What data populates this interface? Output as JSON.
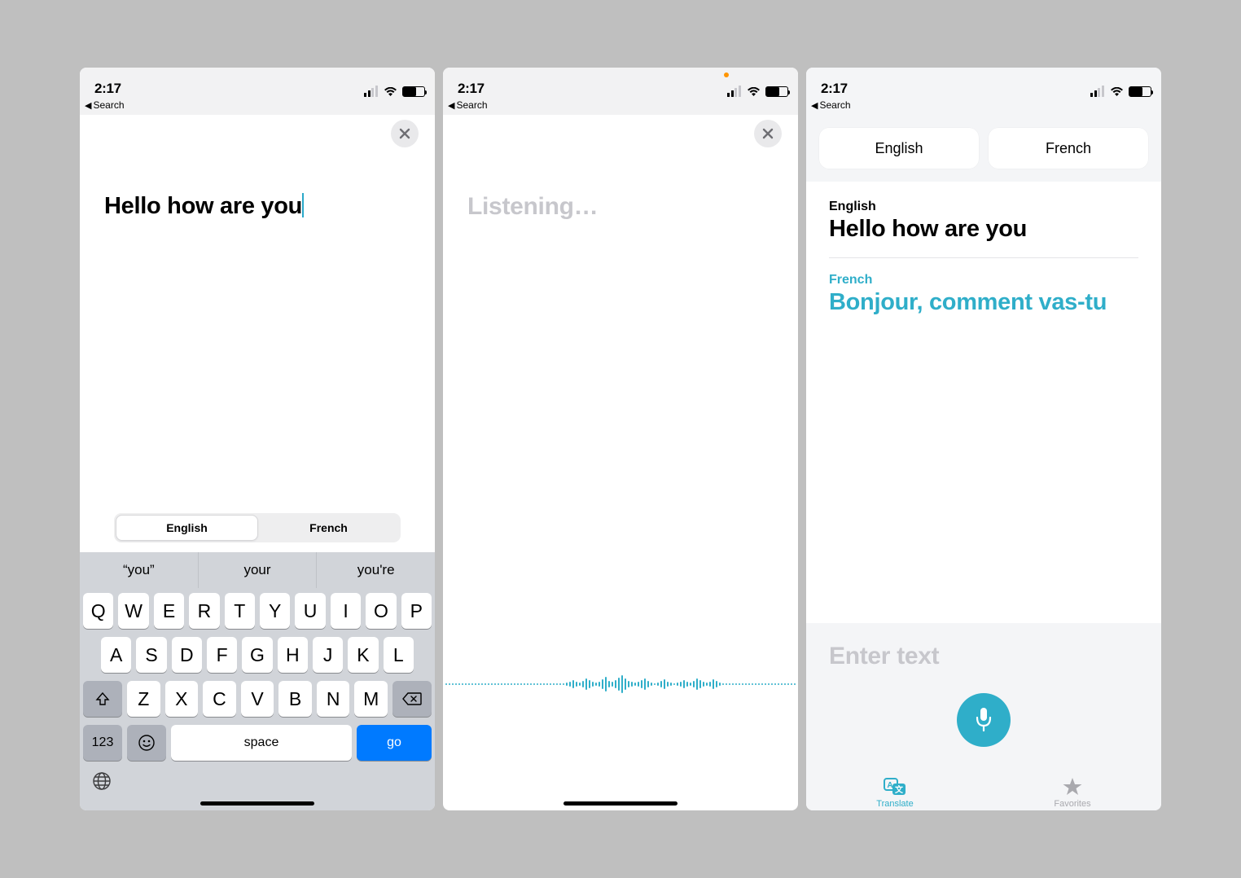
{
  "status": {
    "time": "2:17",
    "back_label": "Search"
  },
  "screen1": {
    "typed_text": "Hello how are you",
    "seg": {
      "source": "English",
      "target": "French"
    },
    "keyboard": {
      "suggestions": [
        "“you”",
        "your",
        "you're"
      ],
      "row1": [
        "Q",
        "W",
        "E",
        "R",
        "T",
        "Y",
        "U",
        "I",
        "O",
        "P"
      ],
      "row2": [
        "A",
        "S",
        "D",
        "F",
        "G",
        "H",
        "J",
        "K",
        "L"
      ],
      "row3": [
        "Z",
        "X",
        "C",
        "V",
        "B",
        "N",
        "M"
      ],
      "num_key": "123",
      "space_key": "space",
      "go_key": "go"
    }
  },
  "screen2": {
    "listening_label": "Listening…"
  },
  "screen3": {
    "pills": {
      "source": "English",
      "target": "French"
    },
    "result": {
      "source_label": "English",
      "source_text": "Hello how are you",
      "target_label": "French",
      "target_text": "Bonjour, comment vas-tu"
    },
    "enter_placeholder": "Enter text",
    "tabs": {
      "translate": "Translate",
      "favorites": "Favorites"
    }
  },
  "colors": {
    "accent": "#2faec9"
  }
}
